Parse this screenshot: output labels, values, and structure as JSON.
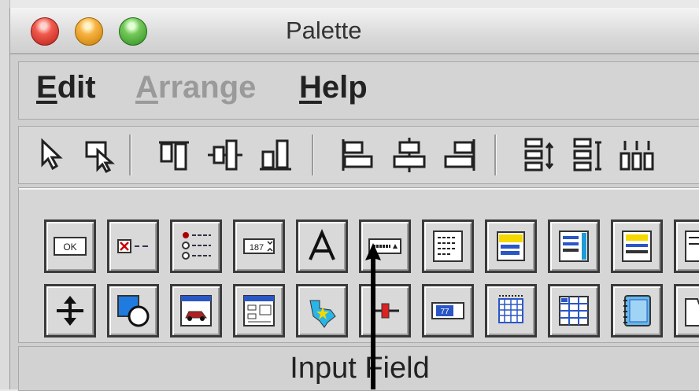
{
  "window": {
    "title": "Palette"
  },
  "menus": [
    {
      "label": "Edit",
      "underline": "E",
      "rest": "dit",
      "enabled": true
    },
    {
      "label": "Arrange",
      "underline": "A",
      "rest": "rrange",
      "enabled": false
    },
    {
      "label": "Help",
      "underline": "H",
      "rest": "elp",
      "enabled": true
    }
  ],
  "palette_row1": [
    "OK",
    "187"
  ],
  "palette_row2": [
    "77"
  ],
  "status": {
    "label": "Input Field"
  },
  "colors": {
    "title_text": "#333333",
    "disabled": "#9a9a9a",
    "window_bg": "#cfcfcf"
  }
}
